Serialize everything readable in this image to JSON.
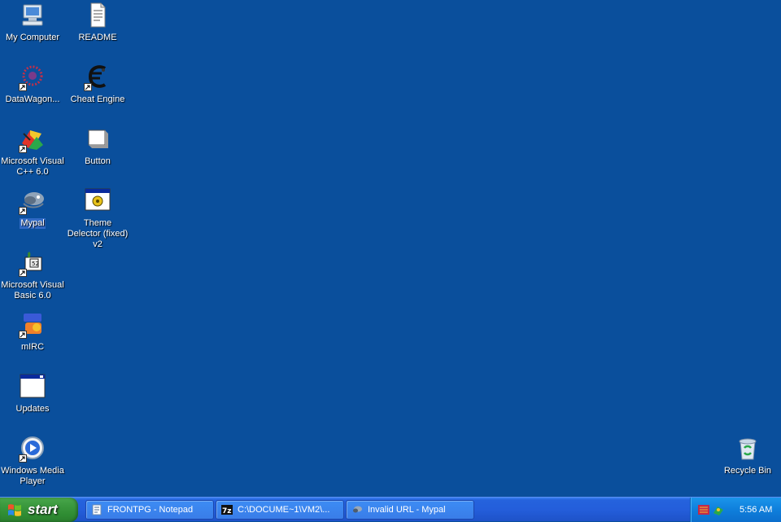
{
  "desktop": {
    "icons": [
      {
        "label": "My Computer",
        "icon": "my-computer-icon"
      },
      {
        "label": "README",
        "icon": "text-document-icon"
      },
      {
        "label": "DataWagon...",
        "icon": "datawagon-icon"
      },
      {
        "label": "Cheat Engine",
        "icon": "cheat-engine-icon"
      },
      {
        "label": "Microsoft Visual C++ 6.0",
        "icon": "visual-cpp-icon"
      },
      {
        "label": "Button",
        "icon": "button-icon"
      },
      {
        "label": "Mypal",
        "icon": "mypal-icon"
      },
      {
        "label": "Theme Delector (fixed) v2",
        "icon": "theme-delector-icon"
      },
      {
        "label": "Microsoft Visual Basic 6.0",
        "icon": "visual-basic-icon"
      },
      {
        "label": "mIRC",
        "icon": "mirc-icon"
      },
      {
        "label": "Updates",
        "icon": "window-icon"
      },
      {
        "label": "Windows Media Player",
        "icon": "media-player-icon"
      },
      {
        "label": "Recycle Bin",
        "icon": "recycle-bin-icon"
      }
    ]
  },
  "taskbar": {
    "start_label": "start",
    "buttons": [
      {
        "label": "FRONTPG - Notepad",
        "icon": "notepad-icon"
      },
      {
        "label": "C:\\DOCUME~1\\VM2\\...",
        "icon": "7zip-icon"
      },
      {
        "label": "Invalid URL - Mypal",
        "icon": "mypal-icon"
      }
    ],
    "tray": {
      "icons": [
        "datawagon-tray-icon",
        "network-tray-icon"
      ],
      "clock": "5:56 AM"
    }
  },
  "colors": {
    "desktop": "#0a4f9c",
    "taskbar": "#245edb",
    "start": "#3c9a3f",
    "tray": "#0f7fdc",
    "selection": "#316ac5"
  }
}
